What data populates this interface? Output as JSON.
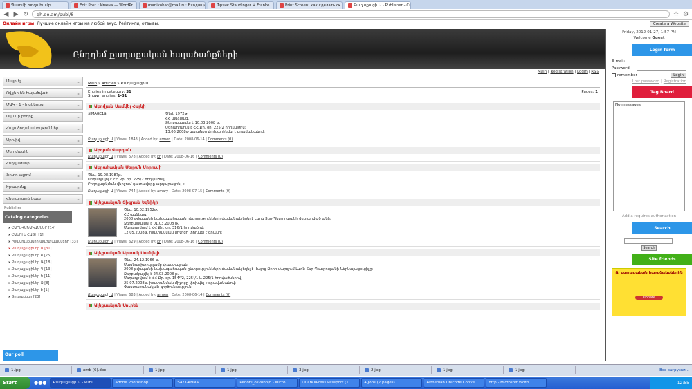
{
  "browser": {
    "tabs": [
      "Պատմի Խոզահամբ...",
      "Edit Post ‹ Имена — WordPr...",
      "manikohar@mail.ru: Входящи...",
      "Фрэнк Staudinger + Franke...",
      "Print Screen: как сделать ск...",
      "Քաղաքացի Ա - Publisher - Cr..."
    ],
    "url": "qh.do.am/publ/8"
  },
  "topbar": {
    "games": "Онлайн игры",
    "promo": "Лучшие онлайн игры на любой вкус. Рейтинги, отзывы.",
    "create": "Create a Website"
  },
  "header": {
    "title": "Ընդդեմ քաղաքական հալածանքների"
  },
  "right": {
    "date": "Friday, 2012-01-27, 1:57 PM",
    "welcome": "Welcome",
    "guest": "Guest",
    "login_title": "Login form",
    "email": "E-mail:",
    "password": "Password:",
    "login_btn": "Login",
    "remember": "remember",
    "lost": "Lost password",
    "register": "Registration",
    "tag_title": "Tag Board",
    "tag_empty": "No messages",
    "auth": "Add a requires authorization",
    "search_title": "Search",
    "search_btn": "Search",
    "friends_title": "Site friends",
    "ad_head": "Ոչ քաղաքական հալածանքներին",
    "ad_btn": "Donate"
  },
  "left": {
    "menu": [
      "Մայր էջ",
      "Ովքեր են հալածված",
      "ՄԱԿ - 1 - ի զեկույց",
      "Ականի բողոք",
      "Հալածողականություններ",
      "Արխիվ",
      "Մեր մասին",
      "Հոդվածներ",
      "Ֆոտո ալբոմ",
      "Իրավունք",
      "Հետադարձ կապ"
    ],
    "publisher": "Publisher",
    "catalog": "Catalog categories",
    "cats": [
      "ՀԱՐԵՎԱՆԱԿԱՆՆԵՐ [14]",
      "ՀԱՆՈՒՆ ՀԱՑԻ [1]",
      "Իրավունքների պաշտպանները [33]",
      "Քաղաքացիներ Ա [31]",
      "Քաղաքացիներ Բ [75]",
      "Քաղաքացիներ Գ [18]",
      "Քաղաքացիներ Դ [13]",
      "Քաղաքացիներ Ե [11]",
      "Քաղաքացիներ Զ [8]",
      "Քաղաքացիներ Է [1]",
      "Ցուցակներ [23]"
    ],
    "poll": "Our poll"
  },
  "main": {
    "links": [
      "Main",
      "Registration",
      "Login",
      "RSS"
    ],
    "breadcrumb": [
      "Main",
      "Articles",
      "Քաղաքացի Ա"
    ],
    "count_label": "Entries in category:",
    "count": "31",
    "shown_label": "Shown entries:",
    "shown": "1-31",
    "pages_label": "Pages:",
    "pages": "1",
    "entries": [
      {
        "title": "Աբովյան Սամվել Հայկի",
        "img": "$IMAGE1$",
        "has_photo": false,
        "text": [
          "Ծնվ. 1972թ.",
          "ՀՀ անձնագ.",
          "Ձերբակալվել է 10.03.2008 թ.",
          "Մեղադրվում է ՀՀ Քր. օր. 225/2 հոդվածով:",
          "13.06.2008թ կալանքը փոխարինվել է գրավականով:"
        ],
        "meta": {
          "cat": "Քաղաքացի Ա",
          "views": "Views: 1843",
          "added": "Added by:",
          "author": "armen",
          "date": "Date: 2008-06-14",
          "comments": "Comments (0)"
        }
      },
      {
        "title": "Աբոյան Վարդան",
        "has_photo": false,
        "text": [],
        "meta": {
          "cat": "Քաղաքացի Ա",
          "views": "Views: 578",
          "added": "Added by:",
          "author": "kr",
          "date": "Date: 2008-06-16",
          "comments": "Comments (0)"
        }
      },
      {
        "title": "Աբրահամյան Սեյրան Մորուսի",
        "has_photo": false,
        "text": [
          "Ծնվ. 19.08.1987թ.",
          "Մեղադրվել է ՀՀ Քր. օր. 225/2 հոդվածով:",
          "Բողոքարկման վերջում դատավորը արդարացրել է:"
        ],
        "meta": {
          "cat": "Քաղաքացի Ա",
          "views": "Views: 744",
          "added": "Added by:",
          "author": "amary",
          "date": "Date: 2008-07-15",
          "comments": "Comments (0)"
        }
      },
      {
        "title": "Ալեքսանյան Տիգրան Եզնիկի",
        "has_photo": true,
        "text": [
          "Ծնվ. 10.02.1952թ.",
          "ՀՀ անձնագ.",
          "2008 թվականի նախագահական ընտրությունների ժամանակ եղել է Լևոն Տեր-Պետրոսյանի վստահված անձ:",
          "Ձերբակալվել է 01.03.2008 թ.",
          "Մեղադրվում է ՀՀ Քր. օր. 316/1 հոդվածով:",
          "12.05.2008թ. խափանման միջոցը փոխվել է գրավի:"
        ],
        "meta": {
          "cat": "Քաղաքացի Ա",
          "views": "Views: 629",
          "added": "Added by:",
          "author": "kr",
          "date": "Date: 2008-06-16",
          "comments": "Comments (0)"
        }
      },
      {
        "title": "Ալեքսանյան Արտակ Սամվելի",
        "has_photo": true,
        "text": [
          "Ծնվ. 24.12.1966 թ.",
          "Մասնագիտությամբ փաստաբան:",
          "2008 թվականի նախագահական ընտրությունների ժամանակ եղել է Վայոց Ձորի մարզում Լևոն Տեր-Պետրոսյանի Ներկայացուցիչը:",
          "Ձերբակալվել է 24.03.2008 թ.",
          "Մեղադրվում է ՀՀ Քր. օր. 154²/2, 225¹/1 և 225/1 հոդվածներով:",
          "25.07.2008թ. խափանման միջոցը փոխվել է գրավականով:",
          "Փաստաբանական գործունեություն:"
        ],
        "meta": {
          "cat": "Քաղաքացի Ա",
          "views": "Views: 683",
          "added": "Added by:",
          "author": "armen",
          "date": "Date: 2008-06-14",
          "comments": "Comments (0)"
        }
      },
      {
        "title": "Ալեքսանյան Սուրեն",
        "has_photo": false,
        "text": [],
        "meta": {
          "cat": "",
          "views": "",
          "added": "",
          "author": "",
          "date": "",
          "comments": ""
        }
      }
    ]
  },
  "downloads": {
    "items": [
      "1.jpg",
      "xmb (6).doc",
      "1.jpg",
      "1.jpg",
      "3.jpg",
      "2.jpg",
      "1.jpg",
      "1.jpg"
    ],
    "all": "Все загрузки..."
  },
  "taskbar": {
    "start": "Start",
    "items": [
      "Քաղաքացի Ա - Publi...",
      "Adobe Photoshop",
      "SAYT-ANNA",
      "Pedofil_osvobojd - Micro...",
      "QuarkXPress Passport (1...",
      "4 Jobs (7 pages)",
      "Armenian Unicode Conve...",
      "http - Microsoft Word"
    ],
    "clock": "12:55"
  }
}
